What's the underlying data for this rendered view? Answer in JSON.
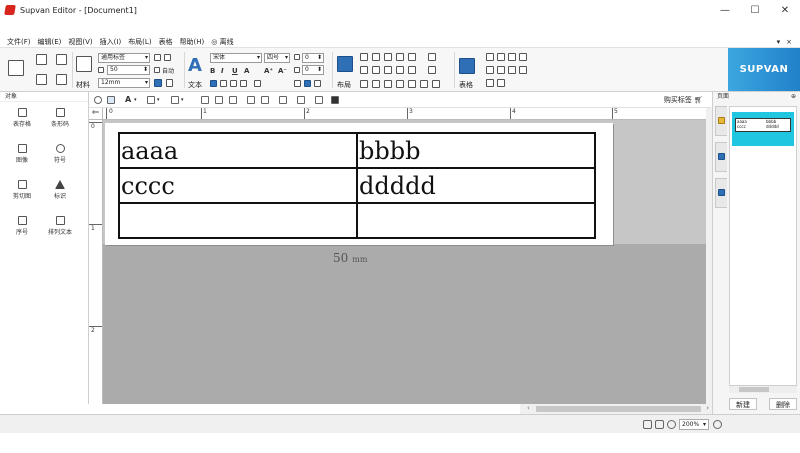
{
  "window": {
    "title": "Supvan Editor - [Document1]",
    "minimize": "—",
    "maximize": "☐",
    "close": "✕"
  },
  "menu": {
    "items": [
      "文件(F)",
      "编辑(E)",
      "视图(V)",
      "插入(I)",
      "布局(L)",
      "表格",
      "帮助(H)",
      "◎ 离线"
    ],
    "right": [
      "▾",
      "×"
    ]
  },
  "ribbon": {
    "material": {
      "type_select": "通用标签",
      "width_value": "50",
      "auto_label": "自动",
      "size_select": "12mm",
      "material_label": "材料"
    },
    "text": {
      "font_select": "宋体",
      "size_select": "四号",
      "spacing1": "0",
      "spacing2": "0",
      "text_label": "文本",
      "bold": "B",
      "italic": "I",
      "underline": "U",
      "font_color": "A",
      "grow": "A⁺",
      "shrink": "A⁻"
    },
    "layout_label": "布局",
    "table_label": "表格",
    "brand": "SUPVAN"
  },
  "left_panel": {
    "header": "对象",
    "items": [
      {
        "label": "表存格",
        "icon": "table-icon"
      },
      {
        "label": "条形码",
        "icon": "barcode-icon"
      },
      {
        "label": "图像",
        "icon": "image-icon"
      },
      {
        "label": "符号",
        "icon": "symbol-icon"
      },
      {
        "label": "剪切图",
        "icon": "clipart-icon"
      },
      {
        "label": "标识",
        "icon": "warning-sign-icon"
      },
      {
        "label": "序号",
        "icon": "serial-icon"
      },
      {
        "label": "排列文本",
        "icon": "arrange-text-icon"
      }
    ]
  },
  "toolbar2": {
    "buy_label": "购买标签"
  },
  "ruler": {
    "h_numbers": [
      "0",
      "1",
      "2",
      "3",
      "4",
      "5"
    ],
    "v_numbers": [
      "0",
      "1",
      "2"
    ]
  },
  "label": {
    "cells": [
      [
        "aaaa",
        "bbbb"
      ],
      [
        "cccc",
        "ddddd"
      ],
      [
        "",
        ""
      ]
    ],
    "dimension": "50",
    "dimension_unit": "mm"
  },
  "right_panel": {
    "header": "页面",
    "pin": "⊕",
    "thumb_cells": [
      "aaaa",
      "bbbb",
      "cccc",
      "ddddd"
    ],
    "new_button": "新建",
    "delete_button": "删除"
  },
  "status": {
    "zoom": "200%"
  },
  "colors": {
    "accent": "#2180c9",
    "thumb_selected": "#20c6e0",
    "canvas_gray": "#ababab",
    "brand_red": "#d8251d"
  }
}
